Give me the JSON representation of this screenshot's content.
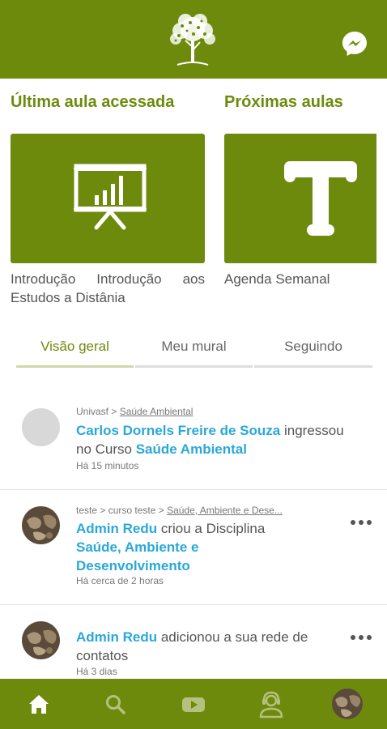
{
  "header": {
    "logo_icon": "tree-logo-icon",
    "messenger_icon": "messenger-icon"
  },
  "sections": {
    "last_lesson_title": "Última aula acessada",
    "next_lessons_title": "Próximas aulas"
  },
  "cards": [
    {
      "icon": "presentation-chart-icon",
      "caption": "Introdução Introdução aos Estudos a Distânia"
    },
    {
      "icon": "text-letter-t-icon",
      "caption": "Agenda Semanal"
    }
  ],
  "tabs": [
    {
      "label": "Visão geral",
      "active": true
    },
    {
      "label": "Meu mural",
      "active": false
    },
    {
      "label": "Seguindo",
      "active": false
    }
  ],
  "feed": [
    {
      "crumb_prefix": "Univasf >",
      "crumb_link": "Saúde Ambiental",
      "actor": "Carlos Dornels Freire de Souza",
      "action": " ingressou no Curso ",
      "target": "Saúde Ambiental",
      "time": "Há 15 minutos"
    },
    {
      "crumb_prefix": "teste > curso teste >",
      "crumb_link": "Saúde, Ambiente e Dese...",
      "actor": "Admin Redu",
      "action": " criou a Disciplina ",
      "target": "Saúde, Ambiente e Desenvolvimento",
      "time": "Há cerca de 2 horas"
    },
    {
      "actor": "Admin Redu",
      "action": " adicionou a sua rede de contatos",
      "time": "Há 3 dias"
    }
  ],
  "bottom_nav": [
    "home-icon",
    "search-icon",
    "video-icon",
    "support-agent-icon",
    "profile-avatar"
  ],
  "colors": {
    "brand_green": "#6e8a0c",
    "link_blue": "#29a8d8"
  }
}
